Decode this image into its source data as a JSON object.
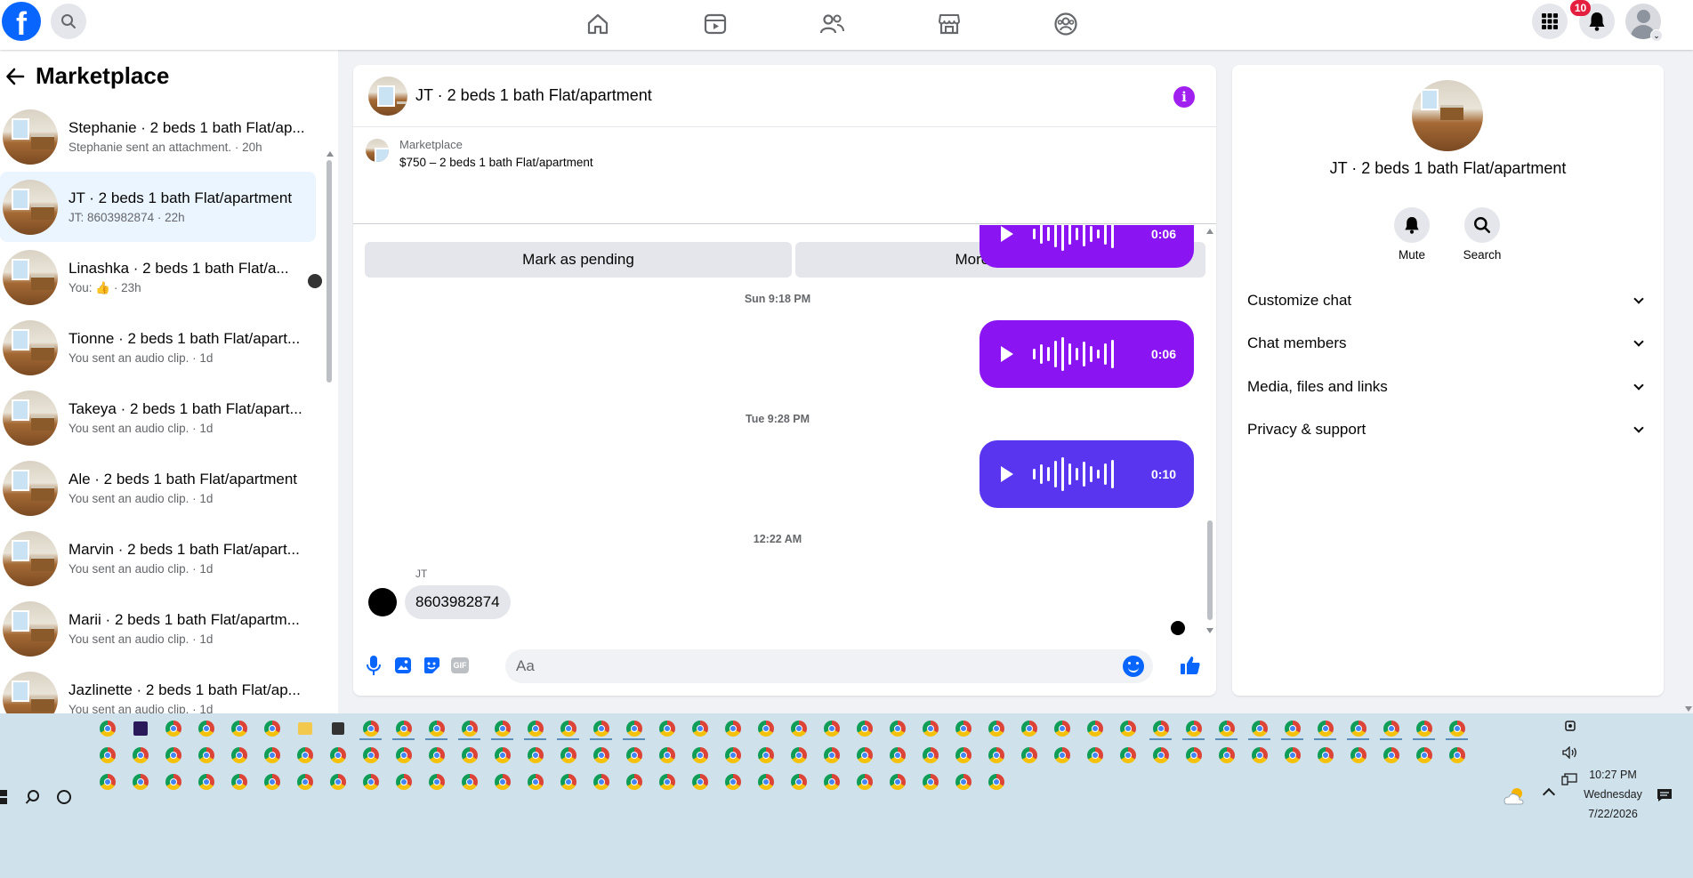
{
  "top_nav": {
    "logo_letter": "f",
    "notification_count": "10",
    "icons": [
      "home-icon",
      "watch-icon",
      "friends-icon",
      "marketplace-icon",
      "groups-icon"
    ]
  },
  "sidebar": {
    "title": "Marketplace",
    "conversations": [
      {
        "title": "Stephanie · 2 beds 1 bath Flat/ap...",
        "sub": "Stephanie sent an attachment. · 20h"
      },
      {
        "title": "JT · 2 beds 1 bath Flat/apartment",
        "sub": "JT: 8603982874 · 22h"
      },
      {
        "title": "Linashka · 2 beds 1 bath Flat/a...",
        "sub": "You: 👍 · 23h"
      },
      {
        "title": "Tionne · 2 beds 1 bath Flat/apart...",
        "sub": "You sent an audio clip. · 1d"
      },
      {
        "title": "Takeya · 2 beds 1 bath Flat/apart...",
        "sub": "You sent an audio clip. · 1d"
      },
      {
        "title": "Ale · 2 beds 1 bath Flat/apartment",
        "sub": "You sent an audio clip. · 1d"
      },
      {
        "title": "Marvin · 2 beds 1 bath Flat/apart...",
        "sub": "You sent an audio clip. · 1d"
      },
      {
        "title": "Marii · 2 beds 1 bath Flat/apartm...",
        "sub": "You sent an audio clip. · 1d"
      },
      {
        "title": "Jazlinette · 2 beds 1 bath Flat/ap...",
        "sub": "You sent an audio clip. · 1d"
      }
    ]
  },
  "chat": {
    "title": "JT · 2 beds 1 bath Flat/apartment",
    "marketplace_label": "Marketplace",
    "listing": "$750 – 2 beds 1 bath Flat/apartment",
    "mark_pending": "Mark as pending",
    "more_options": "More Options",
    "audio_1_duration": "0:06",
    "ts_1": "Sun 9:18 PM",
    "audio_2_duration": "0:06",
    "ts_2": "Tue 9:28 PM",
    "audio_3_duration": "0:10",
    "ts_3": "12:22 AM",
    "sender": "JT",
    "incoming_text": "8603982874",
    "composer_placeholder": "Aa",
    "gif_label": "GIF",
    "colors": {
      "audio_purple": "#8a14f2",
      "audio_blue": "#5a35f0",
      "accent": "#0866ff"
    }
  },
  "right_panel": {
    "title": "JT · 2 beds 1 bath Flat/apartment",
    "mute_label": "Mute",
    "search_label": "Search",
    "rows": [
      "Customize chat",
      "Chat members",
      "Media, files and links",
      "Privacy & support"
    ]
  },
  "taskbar": {
    "time": "10:27 PM",
    "day": "Wednesday",
    "date": "7/22/2026"
  }
}
